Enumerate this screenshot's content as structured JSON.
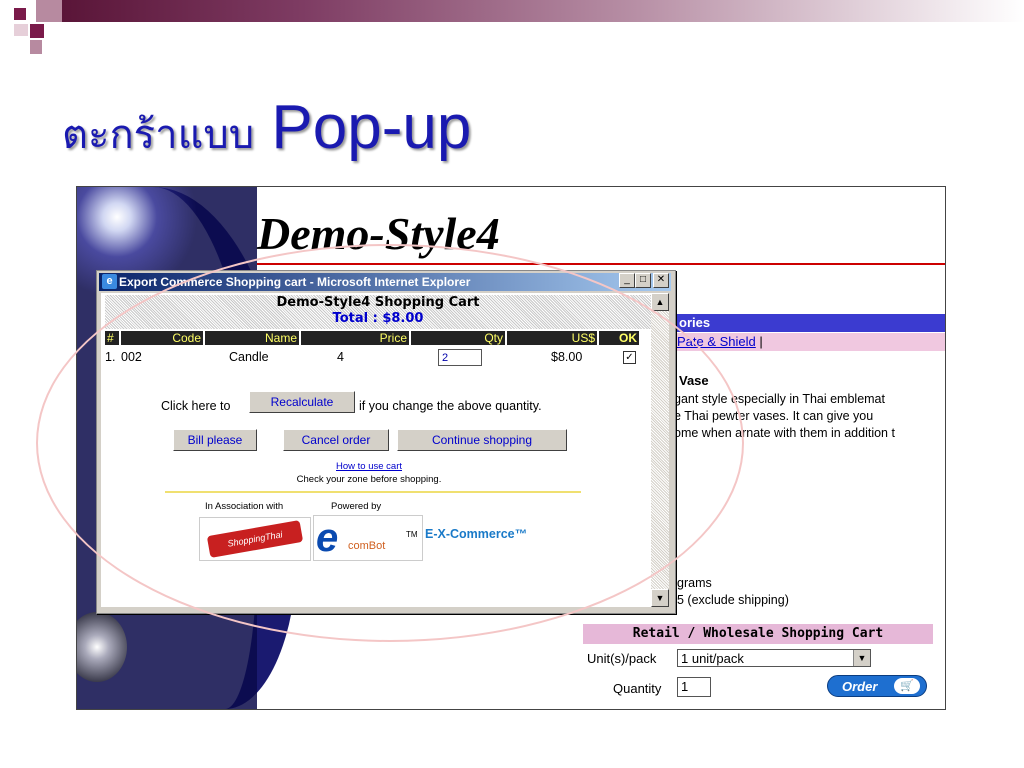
{
  "slide": {
    "title_thai": "ตะกร้าแบบ",
    "title_latin": "Pop-up"
  },
  "site": {
    "title": "Demo-Style4",
    "category_bar": "ories",
    "category_link": "Pate & Shield",
    "category_sep": "|",
    "product_title": "Vase",
    "product_desc": [
      "gant style especially in Thai emblemat",
      "e Thai pewter vases. It can give you",
      "ome when arnate with them in addition t"
    ],
    "weight_line1": "grams",
    "weight_line2": "5 (exclude shipping)",
    "cart_heading": "Retail / Wholesale Shopping Cart",
    "unit_label": "Unit(s)/pack",
    "unit_value": "1 unit/pack",
    "quantity_label": "Quantity",
    "quantity_value": "1",
    "order_label": "Order"
  },
  "popup": {
    "window_title": "Export Commerce Shopping cart - Microsoft Internet Explorer",
    "cart_title": "Demo-Style4 Shopping Cart",
    "total": "Total : $8.00",
    "columns": [
      "#",
      "Code",
      "Name",
      "Price",
      "Qty",
      "US$",
      "OK"
    ],
    "row": {
      "num": "1.",
      "code": "002",
      "name": "Candle",
      "price": "4",
      "qty": "2",
      "usd": "$8.00",
      "ok": "✓"
    },
    "click_here": "Click here to",
    "recalculate": "Recalculate",
    "if_change": "if you change the above quantity.",
    "bill_please": "Bill please",
    "cancel_order": "Cancel order",
    "continue_shopping": "Continue shopping",
    "how_to": "How to use cart",
    "check_zone": "Check your zone before shopping.",
    "in_assoc": "In Association with",
    "powered_by": "Powered by",
    "shopping_logo": "ShoppingThai",
    "ecom_e": "e",
    "ecom_bot": "comBot",
    "ecom_tm": "TM",
    "excommerce": "E-X-Commerce™"
  }
}
